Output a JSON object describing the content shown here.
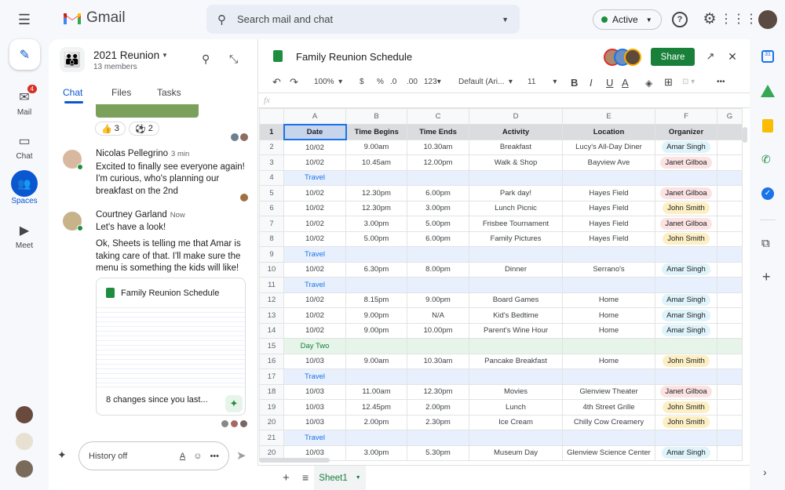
{
  "app": {
    "name": "Gmail",
    "search_placeholder": "Search mail and chat",
    "status": "Active",
    "colors": {
      "accent": "#0b57d0",
      "share": "#188038",
      "active": "#1e8e3e"
    }
  },
  "rail": [
    {
      "label": "Mail",
      "icon": "mail-icon",
      "badge": "4"
    },
    {
      "label": "Chat",
      "icon": "chat-icon"
    },
    {
      "label": "Spaces",
      "icon": "spaces-icon",
      "active": true
    },
    {
      "label": "Meet",
      "icon": "video-icon"
    }
  ],
  "space": {
    "title": "2021 Reunion",
    "members": "13 members",
    "tabs": [
      "Chat",
      "Files",
      "Tasks"
    ],
    "reactions": [
      {
        "emoji": "👍",
        "count": "3"
      },
      {
        "emoji": "⚽",
        "count": "2"
      }
    ],
    "messages": [
      {
        "author": "Nicolas Pellegrino",
        "time": "3 min",
        "text": "Excited to finally see everyone again! I'm curious, who's planning our breakfast on the 2nd"
      },
      {
        "author": "Courtney Garland",
        "time": "Now",
        "text": "Let's have a look!",
        "text2": "Ok, Sheets is telling me that Amar is taking care of that. I'll make sure the menu is something the kids will like!"
      }
    ],
    "card": {
      "title": "Family Reunion Schedule",
      "footer": "8 changes since you last..."
    },
    "input_placeholder": "History off"
  },
  "sheet": {
    "title": "Family Reunion Schedule",
    "share": "Share",
    "toolbar": {
      "zoom": "100%",
      "currency": "$",
      "percent": "%",
      "dec_less": ".0",
      "dec_more": ".00",
      "format": "123",
      "font": "Default (Ari...",
      "size": "11",
      "bold": "B",
      "italic": "I",
      "underline": "U",
      "color": "A"
    },
    "fx": "fx",
    "columns": [
      "A",
      "B",
      "C",
      "D",
      "E",
      "F",
      "G"
    ],
    "headers": [
      "Date",
      "Time Begins",
      "Time Ends",
      "Activity",
      "Location",
      "Organizer"
    ],
    "rows": [
      {
        "n": "2",
        "cells": [
          "10/02",
          "9.00am",
          "10.30am",
          "Breakfast",
          "Lucy's All-Day Diner",
          "Amar Singh"
        ]
      },
      {
        "n": "3",
        "cells": [
          "10/02",
          "10.45am",
          "12.00pm",
          "Walk & Shop",
          "Bayview Ave",
          "Janet Gilboa"
        ]
      },
      {
        "n": "4",
        "section": "Travel"
      },
      {
        "n": "5",
        "cells": [
          "10/02",
          "12.30pm",
          "6.00pm",
          "Park day!",
          "Hayes Field",
          "Janet Gilboa"
        ]
      },
      {
        "n": "6",
        "cells": [
          "10/02",
          "12.30pm",
          "3.00pm",
          "Lunch Picnic",
          "Hayes Field",
          "John Smith"
        ]
      },
      {
        "n": "7",
        "cells": [
          "10/02",
          "3.00pm",
          "5.00pm",
          "Frisbee Tournament",
          "Hayes Field",
          "Janet Gilboa"
        ]
      },
      {
        "n": "8",
        "cells": [
          "10/02",
          "5.00pm",
          "6.00pm",
          "Family Pictures",
          "Hayes Field",
          "John Smith"
        ]
      },
      {
        "n": "9",
        "section": "Travel"
      },
      {
        "n": "10",
        "cells": [
          "10/02",
          "6.30pm",
          "8.00pm",
          "Dinner",
          "Serrano's",
          "Amar Singh"
        ]
      },
      {
        "n": "11",
        "section": "Travel"
      },
      {
        "n": "12",
        "cells": [
          "10/02",
          "8.15pm",
          "9.00pm",
          "Board Games",
          "Home",
          "Amar Singh"
        ]
      },
      {
        "n": "13",
        "cells": [
          "10/02",
          "9.00pm",
          "N/A",
          "Kid's Bedtime",
          "Home",
          "Amar Singh"
        ]
      },
      {
        "n": "14",
        "cells": [
          "10/02",
          "9.00pm",
          "10.00pm",
          "Parent's Wine Hour",
          "Home",
          "Amar Singh"
        ]
      },
      {
        "n": "15",
        "section": "Day Two",
        "day": true
      },
      {
        "n": "16",
        "cells": [
          "10/03",
          "9.00am",
          "10.30am",
          "Pancake Breakfast",
          "Home",
          "John Smith"
        ]
      },
      {
        "n": "17",
        "section": "Travel"
      },
      {
        "n": "18",
        "cells": [
          "10/03",
          "11.00am",
          "12.30pm",
          "Movies",
          "Glenview Theater",
          "Janet Gilboa"
        ]
      },
      {
        "n": "19",
        "cells": [
          "10/03",
          "12.45pm",
          "2.00pm",
          "Lunch",
          "4th Street Grille",
          "John Smith"
        ]
      },
      {
        "n": "20",
        "cells": [
          "10/03",
          "2.00pm",
          "2.30pm",
          "Ice Cream",
          "Chilly Cow Creamery",
          "John Smith"
        ]
      },
      {
        "n": "21",
        "section": "Travel"
      },
      {
        "n": "20",
        "cells": [
          "10/03",
          "3.00pm",
          "5.30pm",
          "Museum Day",
          "Glenview Science Center",
          "Amar Singh"
        ]
      }
    ],
    "organizer_colors": {
      "Amar Singh": "#dff3fa",
      "Janet Gilboa": "#fce3e3",
      "John Smith": "#fcefc3"
    },
    "sheet_tab": "Sheet1"
  }
}
